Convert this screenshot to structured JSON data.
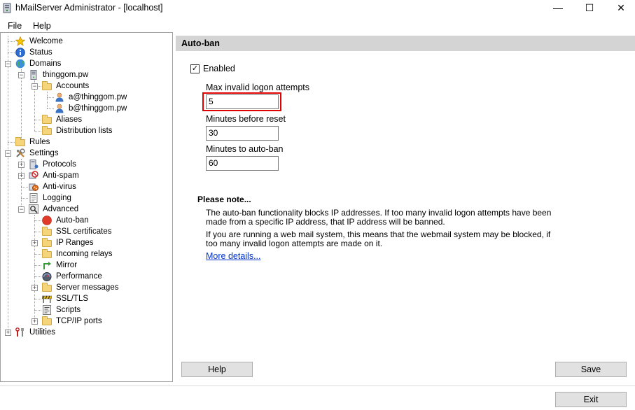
{
  "window": {
    "title": "hMailServer Administrator - [localhost]",
    "min": "—",
    "max": "☐",
    "close": "✕"
  },
  "menu": [
    {
      "label": "File"
    },
    {
      "label": "Help"
    }
  ],
  "tree": {
    "welcome": "Welcome",
    "status": "Status",
    "domains": "Domains",
    "domain": "thinggom.pw",
    "accounts": "Accounts",
    "account1": "a@thinggom.pw",
    "account2": "b@thinggom.pw",
    "aliases": "Aliases",
    "distribution": "Distribution lists",
    "rules": "Rules",
    "settings": "Settings",
    "protocols": "Protocols",
    "antispam": "Anti-spam",
    "antivirus": "Anti-virus",
    "logging": "Logging",
    "advanced": "Advanced",
    "autoban": "Auto-ban",
    "sslcerts": "SSL certificates",
    "ipranges": "IP Ranges",
    "incoming": "Incoming relays",
    "mirror": "Mirror",
    "performance": "Performance",
    "servermessages": "Server messages",
    "ssltls": "SSL/TLS",
    "scripts": "Scripts",
    "tcpip": "TCP/IP ports",
    "utilities": "Utilities"
  },
  "panel": {
    "title": "Auto-ban",
    "enabled_label": "Enabled",
    "enabled_checked": true,
    "check_mark": "✓",
    "max_attempts_label": "Max invalid logon attempts",
    "max_attempts_value": "5",
    "minutes_reset_label": "Minutes before reset",
    "minutes_reset_value": "30",
    "minutes_ban_label": "Minutes to auto-ban",
    "minutes_ban_value": "60",
    "note_title": "Please note...",
    "note_line1": "The auto-ban functionality blocks IP addresses. If too many invalid logon attempts have been",
    "note_line2": "made from a specific IP address, that IP address will be banned.",
    "note_line3": "If you are running a web mail system, this means that the webmail system may be blocked, if",
    "note_line4": "too many invalid logon attempts are made on it.",
    "more_details": "More details...",
    "help_button": "Help",
    "save_button": "Save"
  },
  "footer": {
    "exit_button": "Exit"
  }
}
